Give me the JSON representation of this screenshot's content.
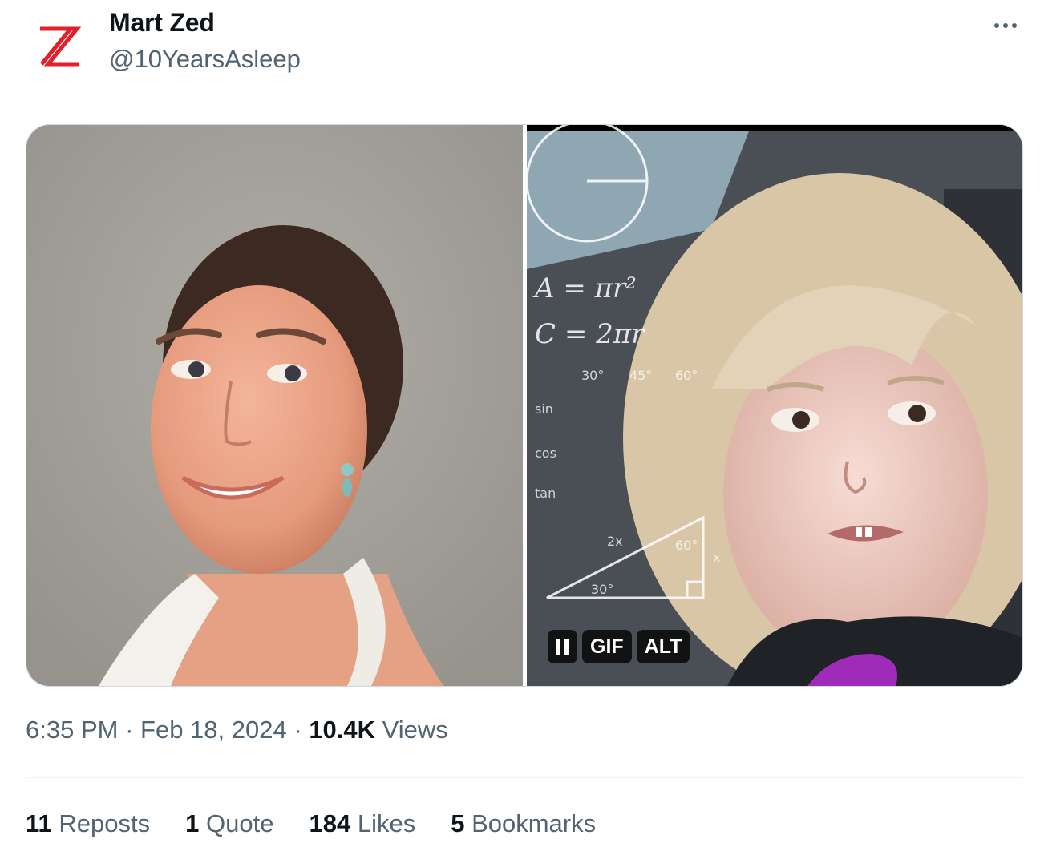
{
  "author": {
    "display_name": "Mart Zed",
    "handle": "@10YearsAsleep",
    "avatar_icon": "red-z-logo-icon",
    "avatar_color": "#e0202b"
  },
  "menu": {
    "more_icon": "more-horizontal-icon"
  },
  "media": {
    "left_image": "photo-smiling-woman",
    "right_image": "gif-confused-girl-math-equations",
    "gif_label": "GIF",
    "alt_label": "ALT",
    "pause_icon": "pause-icon",
    "math_overlay": [
      "A = πr²",
      "C = 2πr",
      "30°",
      "45°",
      "60°",
      "sin",
      "cos",
      "tan",
      "2x",
      "60°",
      "30°",
      "x"
    ]
  },
  "meta": {
    "time": "6:35 PM",
    "separator": "·",
    "date": "Feb 18, 2024",
    "views_count": "10.4K",
    "views_label": "Views"
  },
  "stats": {
    "reposts_count": "11",
    "reposts_label": "Reposts",
    "quotes_count": "1",
    "quotes_label": "Quote",
    "likes_count": "184",
    "likes_label": "Likes",
    "bookmarks_count": "5",
    "bookmarks_label": "Bookmarks"
  },
  "colors": {
    "text_primary": "#0f1419",
    "text_secondary": "#536471",
    "border": "#cfd9de"
  }
}
